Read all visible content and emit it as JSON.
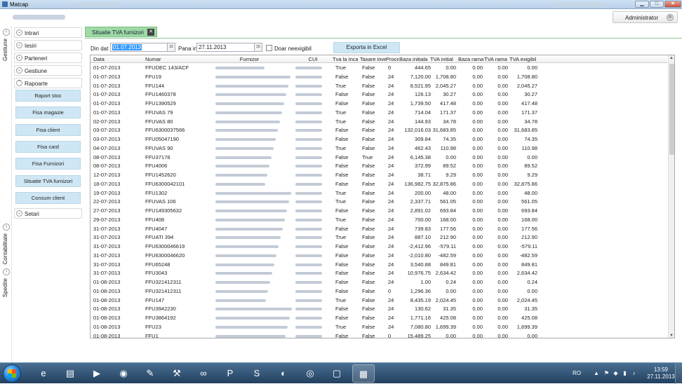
{
  "window": {
    "title": "Matcap"
  },
  "header": {
    "user_label": "Administrator"
  },
  "rail": {
    "gestiune": "Gestiune",
    "contabilitate": "Contabilitate",
    "spedite": "Spedite"
  },
  "nav": {
    "sections": [
      {
        "label": "Intrari"
      },
      {
        "label": "Iesiri"
      },
      {
        "label": "Parteneri"
      },
      {
        "label": "Gestiune"
      },
      {
        "label": "Rapoarte"
      }
    ],
    "rapoarte_items": [
      "Raport stoc",
      "Fisa magazie",
      "Fisa client",
      "Fisa card",
      "Fisa Furnizori",
      "Situatie TVA furnizori",
      "Consum client"
    ],
    "setari": "Setari"
  },
  "tab": {
    "label": "Situatie TVA furnizori",
    "close": "✕"
  },
  "toolbar": {
    "from_label": "Din dat",
    "from_value": "01.07.2013",
    "to_label": "Pana in",
    "to_value": "27.11.2013",
    "only_unpaid_label": "Doar neexigibil",
    "export_label": "Exporta in Excel"
  },
  "grid": {
    "columns": [
      "Data",
      "Numar",
      "Furnizor",
      "CUI",
      "Tva la Inca",
      "Taxare inve",
      "Proce",
      "Baza initiala",
      "TVA initial",
      "Baza rama",
      "TVA rama",
      "TVA exigibil"
    ],
    "rows": [
      [
        "01-07-2013",
        "FFUDEC 143/ACF",
        "True",
        "False",
        "0",
        "444.65",
        "0.00",
        "0.00",
        "0.00",
        "0.00"
      ],
      [
        "01-07-2013",
        "FFU19",
        "False",
        "False",
        "24",
        "7,120.00",
        "1,708.80",
        "0.00",
        "0.00",
        "1,708.80"
      ],
      [
        "01-07-2013",
        "FFU144",
        "True",
        "False",
        "24",
        "8,521.95",
        "2,045.27",
        "0.00",
        "0.00",
        "2,045.27"
      ],
      [
        "01-07-2013",
        "FFU1460378",
        "False",
        "False",
        "24",
        "126.13",
        "30.27",
        "0.00",
        "0.00",
        "30.27"
      ],
      [
        "01-07-2013",
        "FFU1390529",
        "False",
        "False",
        "24",
        "1,739.50",
        "417.48",
        "0.00",
        "0.00",
        "417.48"
      ],
      [
        "01-07-2013",
        "FFUVAS 79",
        "True",
        "False",
        "24",
        "714.04",
        "171.37",
        "0.00",
        "0.00",
        "171.37"
      ],
      [
        "02-07-2013",
        "FFUVAS 80",
        "True",
        "False",
        "24",
        "144.93",
        "34.78",
        "0.00",
        "0.00",
        "34.78"
      ],
      [
        "03-07-2013",
        "FFU6300037566",
        "False",
        "False",
        "24",
        "132,016.03",
        "31,683.85",
        "0.00",
        "0.00",
        "31,683.85"
      ],
      [
        "03-07-2013",
        "FFU05047190",
        "False",
        "False",
        "24",
        "309.84",
        "74.35",
        "0.00",
        "0.00",
        "74.35"
      ],
      [
        "04-07-2013",
        "FFUVAS 90",
        "True",
        "False",
        "24",
        "462.43",
        "110.98",
        "0.00",
        "0.00",
        "110.98"
      ],
      [
        "08-07-2013",
        "FFU37178",
        "False",
        "True",
        "24",
        "6,145.38",
        "0.00",
        "0.00",
        "0.00",
        "0.00"
      ],
      [
        "08-07-2013",
        "FFU4006",
        "False",
        "False",
        "24",
        "372.99",
        "89.52",
        "0.00",
        "0.00",
        "89.52"
      ],
      [
        "12-07-2013",
        "FFU1452620",
        "False",
        "False",
        "24",
        "38.71",
        "9.29",
        "0.00",
        "0.00",
        "9.29"
      ],
      [
        "18-07-2013",
        "FFU6300042101",
        "False",
        "False",
        "24",
        "136,982.75",
        "32,875.86",
        "0.00",
        "0.00",
        "32,875.86"
      ],
      [
        "19-07-2013",
        "FFU1302",
        "True",
        "False",
        "24",
        "200.00",
        "48.00",
        "0.00",
        "0.00",
        "48.00"
      ],
      [
        "22-07-2013",
        "FFUVAS 106",
        "True",
        "False",
        "24",
        "2,337.71",
        "561.05",
        "0.00",
        "0.00",
        "561.05"
      ],
      [
        "27-07-2013",
        "FFU149305632",
        "False",
        "False",
        "24",
        "2,891.02",
        "693.84",
        "0.00",
        "0.00",
        "693.84"
      ],
      [
        "29-07-2013",
        "FFU408",
        "True",
        "False",
        "24",
        "700.00",
        "168.00",
        "0.00",
        "0.00",
        "168.00"
      ],
      [
        "31-07-2013",
        "FFU4047",
        "False",
        "False",
        "24",
        "739.83",
        "177.56",
        "0.00",
        "0.00",
        "177.56"
      ],
      [
        "31-07-2013",
        "FFUATI 394",
        "True",
        "False",
        "24",
        "887.10",
        "212.90",
        "0.00",
        "0.00",
        "212.90"
      ],
      [
        "31-07-2013",
        "FFU6300046619",
        "False",
        "False",
        "24",
        "-2,412.96",
        "-579.11",
        "0.00",
        "0.00",
        "-579.11"
      ],
      [
        "31-07-2013",
        "FFU6300046620",
        "False",
        "False",
        "24",
        "-2,010.80",
        "-482.59",
        "0.00",
        "0.00",
        "-482.59"
      ],
      [
        "31-07-2013",
        "FFU65248",
        "False",
        "False",
        "24",
        "3,540.88",
        "849.81",
        "0.00",
        "0.00",
        "849.81"
      ],
      [
        "31-07-2013",
        "FFU3043",
        "False",
        "False",
        "24",
        "10,976.75",
        "2,634.42",
        "0.00",
        "0.00",
        "2,634.42"
      ],
      [
        "01-08-2013",
        "FFU321412311",
        "False",
        "False",
        "24",
        "1.00",
        "0.24",
        "0.00",
        "0.00",
        "0.24"
      ],
      [
        "01-08-2013",
        "FFU321412311",
        "False",
        "False",
        "0",
        "1,296.36",
        "0.00",
        "0.00",
        "0.00",
        "0.00"
      ],
      [
        "01-08-2013",
        "FFU147",
        "True",
        "False",
        "24",
        "8,435.19",
        "2,024.45",
        "0.00",
        "0.00",
        "2,024.45"
      ],
      [
        "01-08-2013",
        "FFU3942230",
        "False",
        "False",
        "24",
        "130.62",
        "31.35",
        "0.00",
        "0.00",
        "31.35"
      ],
      [
        "01-08-2013",
        "FFU3864192",
        "False",
        "False",
        "24",
        "1,771.16",
        "425.08",
        "0.00",
        "0.00",
        "425.08"
      ],
      [
        "01-08-2013",
        "FFU23",
        "True",
        "False",
        "24",
        "7,080.80",
        "1,699.39",
        "0.00",
        "0.00",
        "1,699.39"
      ],
      [
        "01-08-2013",
        "FFU1",
        "False",
        "False",
        "0",
        "15,489.25",
        "0.00",
        "0.00",
        "0.00",
        "0.00"
      ]
    ]
  },
  "taskbar": {
    "lang": "RO",
    "time": "13:59",
    "date": "27.11.2013"
  }
}
